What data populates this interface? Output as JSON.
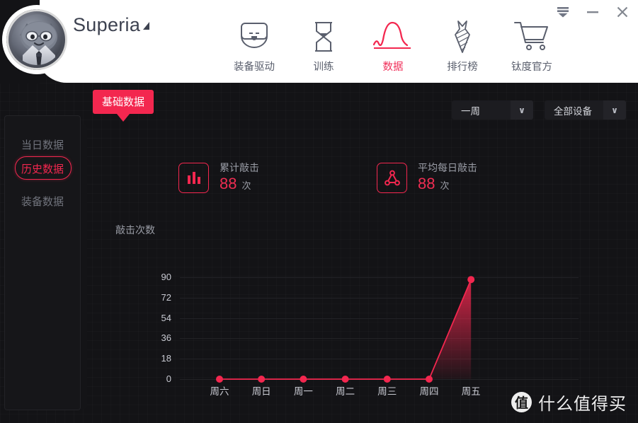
{
  "window": {
    "app_title": "Superia",
    "controls": [
      {
        "name": "collapse-to-tray-button",
        "glyph": "collapse"
      },
      {
        "name": "minimize-button",
        "glyph": "minimize"
      },
      {
        "name": "close-button",
        "glyph": "close"
      }
    ]
  },
  "nav": {
    "items": [
      {
        "label": "装备驱动",
        "icon": "mouse-icon",
        "active": false
      },
      {
        "label": "训练",
        "icon": "hourglass-icon",
        "active": false
      },
      {
        "label": "数据",
        "icon": "wave-chart-icon",
        "active": true
      },
      {
        "label": "排行榜",
        "icon": "necktie-icon",
        "active": false
      },
      {
        "label": "钛度官方",
        "icon": "shopping-cart-icon",
        "active": false
      }
    ]
  },
  "badge": {
    "label": "基础数据"
  },
  "sidebar": {
    "items": [
      {
        "label": "当日数据",
        "active": false
      },
      {
        "label": "历史数据",
        "active": true
      },
      {
        "label": "装备数据",
        "active": false
      }
    ]
  },
  "filters": {
    "period": {
      "value": "一周",
      "arrow": "∨"
    },
    "device": {
      "value": "全部设备",
      "arrow": "∨"
    }
  },
  "stats": [
    {
      "label": "累计敲击",
      "value": "88",
      "unit": "次",
      "icon": "bar-chart-icon"
    },
    {
      "label": "平均每日敲击",
      "value": "88",
      "unit": "次",
      "icon": "node-triangle-icon"
    }
  ],
  "colors": {
    "accent": "#f3274f",
    "accent_text": "#ef2d52",
    "background": "#131316",
    "panel": "#161619",
    "header": "#ffffff",
    "muted_text": "#9a9da6"
  },
  "watermark": {
    "logo_char": "值",
    "text": "什么值得买"
  },
  "chart_data": {
    "type": "line",
    "title": "敲击次数",
    "xlabel": "",
    "ylabel": "敲击次数",
    "categories": [
      "周六",
      "周日",
      "周一",
      "周二",
      "周三",
      "周四",
      "周五"
    ],
    "values": [
      0,
      0,
      0,
      0,
      0,
      0,
      88
    ],
    "yticks": [
      90,
      72,
      54,
      36,
      18,
      0
    ],
    "ylim": [
      0,
      90
    ],
    "grid": true,
    "legend": "none",
    "series": [
      {
        "name": "敲击次数",
        "values": [
          0,
          0,
          0,
          0,
          0,
          0,
          88
        ],
        "color": "#f3274f",
        "fill": true
      }
    ]
  }
}
